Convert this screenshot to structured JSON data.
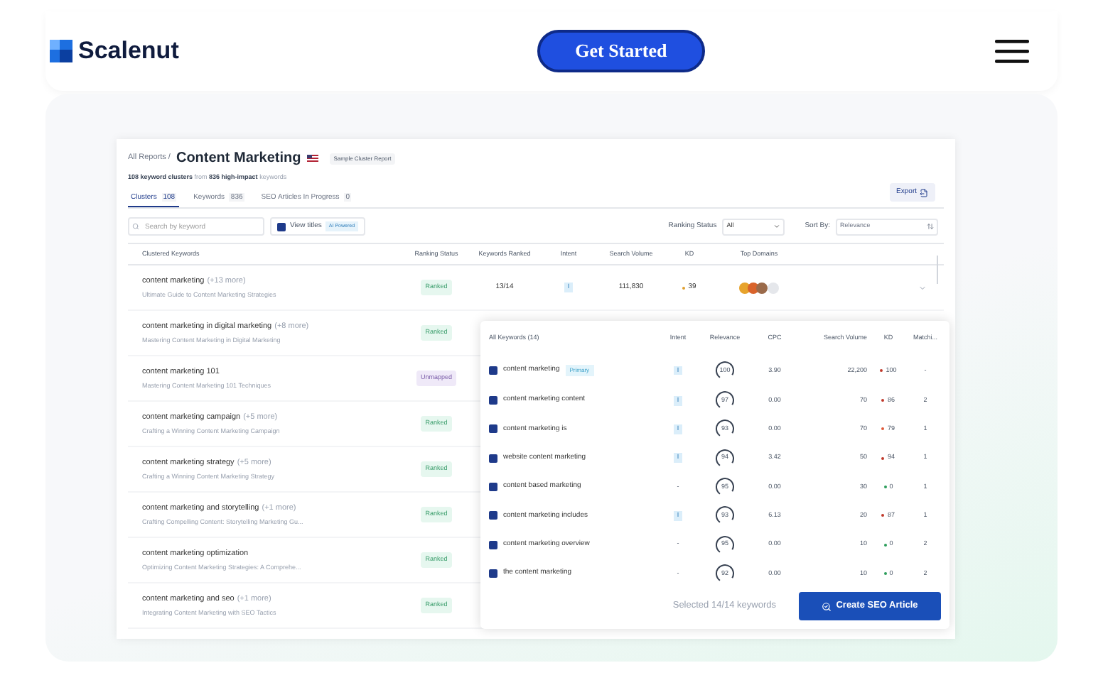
{
  "header": {
    "logo": "Scalenut",
    "cta": "Get Started"
  },
  "report": {
    "breadcrumb": "All Reports /",
    "title": "Content Marketing",
    "badge": "Sample Cluster Report",
    "summary": "**108 keyword clusters** from **836 high-impact** keywords",
    "export": "Export",
    "tabs": [
      {
        "label": "Clusters",
        "count": "108",
        "selected": true
      },
      {
        "label": "Keywords",
        "count": "836",
        "selected": false
      },
      {
        "label": "SEO Articles In Progress",
        "count": "0",
        "selected": false
      }
    ],
    "search": {
      "placeholder": "Search by keyword"
    },
    "view_titles": {
      "label": "View titles",
      "checked": true,
      "badge": "AI Powered"
    },
    "ranking_filter": {
      "label": "Ranking Status",
      "value": "All"
    },
    "sort": {
      "label": "Sort By:",
      "value": "Relevance"
    },
    "columns": [
      "Clustered Keywords",
      "Ranking Status",
      "Keywords Ranked",
      "Intent",
      "Search Volume",
      "KD",
      "Top Domains"
    ],
    "rows": [
      {
        "keyword": "content marketing",
        "more": "(+13 more)",
        "title": "Ultimate Guide to Content Marketing Strategies",
        "status": {
          "label": "Ranked",
          "kind": "ranked"
        },
        "ranked": "13/14",
        "intent": "I",
        "volume": "111,830",
        "kd": "39",
        "color": "#e0a030"
      },
      {
        "keyword": "content marketing in digital marketing",
        "more": "(+8 more)",
        "title": "Mastering Content Marketing in Digital Marketing",
        "status": {
          "label": "Ranked",
          "kind": "ranked"
        }
      },
      {
        "keyword": "content marketing 101",
        "title": "Mastering Content Marketing 101 Techniques",
        "status": {
          "label": "Unmapped",
          "kind": "unmapped"
        }
      },
      {
        "keyword": "content marketing campaign",
        "more": "(+5 more)",
        "title": "Crafting a Winning Content Marketing Campaign",
        "status": {
          "label": "Ranked",
          "kind": "ranked"
        }
      },
      {
        "keyword": "content marketing strategy",
        "more": "(+5 more)",
        "title": "Crafting a Winning Content Marketing Strategy",
        "status": {
          "label": "Ranked",
          "kind": "ranked"
        }
      },
      {
        "keyword": "content marketing and storytelling",
        "more": "(+1 more)",
        "title": "Crafting Compelling Content: Storytelling Marketing Gu...",
        "status": {
          "label": "Ranked",
          "kind": "ranked"
        }
      },
      {
        "keyword": "content marketing optimization",
        "title": "Optimizing Content Marketing Strategies: A Comprehe...",
        "status": {
          "label": "Ranked",
          "kind": "ranked"
        }
      },
      {
        "keyword": "content marketing and seo",
        "more": "(+1 more)",
        "title": "Integrating Content Marketing with SEO Tactics",
        "status": {
          "label": "Ranked",
          "kind": "ranked"
        }
      }
    ]
  },
  "keywords_panel": {
    "columns": [
      "All Keywords (14)",
      "Intent",
      "Relevance",
      "CPC",
      "Search Volume",
      "KD",
      "Matchi..."
    ],
    "rows": [
      {
        "keyword": "content marketing",
        "badge": "Primary",
        "checked": true,
        "intent": {
          "label": "I",
          "kind": "badge"
        },
        "relevance": "100",
        "cpc": "3.90",
        "volume": "22,200",
        "kd": "100",
        "color": "#c0392b",
        "matching": "-"
      },
      {
        "keyword": "content marketing content",
        "checked": true,
        "intent": {
          "label": "I",
          "kind": "badge"
        },
        "relevance": "97",
        "cpc": "0.00",
        "volume": "70",
        "kd": "86",
        "color": "#c0392b",
        "matching": "2"
      },
      {
        "keyword": "content marketing is",
        "checked": true,
        "intent": {
          "label": "I",
          "kind": "badge"
        },
        "relevance": "93",
        "cpc": "0.00",
        "volume": "70",
        "kd": "79",
        "color": "#e05a3a",
        "matching": "1"
      },
      {
        "keyword": "website content marketing",
        "checked": true,
        "intent": {
          "label": "I",
          "kind": "badge"
        },
        "relevance": "94",
        "cpc": "3.42",
        "volume": "50",
        "kd": "94",
        "color": "#c0392b",
        "matching": "1"
      },
      {
        "keyword": "content based marketing",
        "checked": true,
        "intent": {
          "label": "-",
          "kind": "plain"
        },
        "relevance": "95",
        "cpc": "0.00",
        "volume": "30",
        "kd": "0",
        "color": "#2e9e5b",
        "matching": "1"
      },
      {
        "keyword": "content marketing includes",
        "checked": true,
        "intent": {
          "label": "I",
          "kind": "badge"
        },
        "relevance": "93",
        "cpc": "6.13",
        "volume": "20",
        "kd": "87",
        "color": "#c0392b",
        "matching": "1"
      },
      {
        "keyword": "content marketing overview",
        "checked": true,
        "intent": {
          "label": "-",
          "kind": "plain"
        },
        "relevance": "95",
        "cpc": "0.00",
        "volume": "10",
        "kd": "0",
        "color": "#2e9e5b",
        "matching": "2"
      },
      {
        "keyword": "the content marketing",
        "checked": true,
        "intent": {
          "label": "-",
          "kind": "plain"
        },
        "relevance": "92",
        "cpc": "0.00",
        "volume": "10",
        "kd": "0",
        "color": "#2e9e5b",
        "matching": "2"
      }
    ],
    "selected_text": "Selected 14/14 keywords",
    "action": "Create SEO Article"
  }
}
